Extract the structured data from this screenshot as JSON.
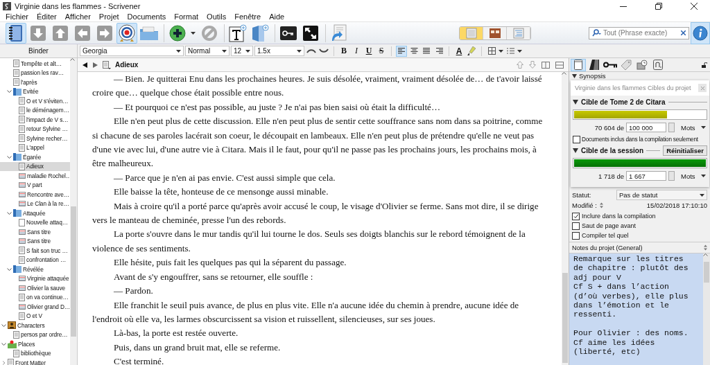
{
  "window": {
    "title": "Virginie dans les flammes - Scrivener"
  },
  "menu": [
    "Fichier",
    "Éditer",
    "Afficher",
    "Projet",
    "Documents",
    "Format",
    "Outils",
    "Fenêtre",
    "Aide"
  ],
  "toolbar": {
    "buttons": [
      {
        "kind": "binder",
        "selected": true
      },
      {
        "kind": "down",
        "selected": false
      },
      {
        "kind": "up",
        "selected": false
      },
      {
        "kind": "left",
        "selected": false
      },
      {
        "kind": "right",
        "selected": false
      },
      {
        "kind": "target",
        "selected": true
      },
      {
        "kind": "folder",
        "selected": false
      },
      {
        "kind": "add",
        "selected": false
      },
      {
        "kind": "delete",
        "selected": false
      },
      {
        "kind": "new-text",
        "selected": false
      },
      {
        "kind": "new-document",
        "selected": false
      },
      {
        "kind": "keywords",
        "selected": false
      },
      {
        "kind": "fullscreen",
        "selected": false
      },
      {
        "kind": "import",
        "selected": false
      }
    ],
    "view_modes": [
      {
        "kind": "document",
        "selected": true
      },
      {
        "kind": "corkboard",
        "selected": false
      },
      {
        "kind": "outline",
        "selected": false
      }
    ],
    "search": {
      "placeholder": "Tout (Phrase exacte)"
    }
  },
  "binder": {
    "title": "Binder",
    "draft_items": [
      {
        "label": "Tempête et alt…",
        "kind": "text",
        "selected": false
      },
      {
        "label": "passion les rav…",
        "kind": "text",
        "selected": false
      },
      {
        "label": "l'après",
        "kind": "text",
        "selected": false
      },
      {
        "label": "Evitée",
        "kind": "folder",
        "selected": false,
        "expanded": true,
        "children": [
          {
            "label": "O et V s'éviten…",
            "kind": "text",
            "selected": false
          },
          {
            "label": "le déménagem…",
            "kind": "text",
            "selected": false
          },
          {
            "label": "l'impact de V s…",
            "kind": "text",
            "selected": false
          },
          {
            "label": "retour Sylvine …",
            "kind": "text",
            "selected": false
          },
          {
            "label": "Sylvine recher…",
            "kind": "text",
            "selected": false
          },
          {
            "label": "L'appel",
            "kind": "text",
            "selected": false
          }
        ]
      },
      {
        "label": "Égarée",
        "kind": "folder",
        "selected": false,
        "expanded": true,
        "children": [
          {
            "label": "Adieux",
            "kind": "text",
            "selected": true
          },
          {
            "label": "maladie Rochel…",
            "kind": "card",
            "selected": false
          },
          {
            "label": "V part",
            "kind": "card",
            "selected": false
          },
          {
            "label": "Rencontre ave…",
            "kind": "card",
            "selected": false
          },
          {
            "label": "Le Clan à la re…",
            "kind": "card",
            "selected": false
          }
        ]
      },
      {
        "label": "Attaquée",
        "kind": "folder",
        "selected": false,
        "expanded": true,
        "children": [
          {
            "label": "Nouvelle attaq…",
            "kind": "blank",
            "selected": false
          },
          {
            "label": "Sans titre",
            "kind": "card",
            "selected": false
          },
          {
            "label": "Sans titre",
            "kind": "card",
            "selected": false
          },
          {
            "label": "S fait son truc …",
            "kind": "text",
            "selected": false
          },
          {
            "label": "confrontation …",
            "kind": "text",
            "selected": false
          }
        ]
      },
      {
        "label": "Révélée",
        "kind": "folder",
        "selected": false,
        "expanded": true,
        "children": [
          {
            "label": "Virginie attaquée",
            "kind": "card",
            "selected": false
          },
          {
            "label": "Olivier la sauve",
            "kind": "card",
            "selected": false
          },
          {
            "label": "on va continue…",
            "kind": "text",
            "selected": false
          },
          {
            "label": "Olivier grand D…",
            "kind": "card",
            "selected": false
          },
          {
            "label": "O et V",
            "kind": "text",
            "selected": false
          }
        ]
      }
    ],
    "root_items": [
      {
        "label": "Characters",
        "kind": "characters",
        "selected": false,
        "expanded": true,
        "children": [
          {
            "label": "persos par ordre…",
            "kind": "text",
            "selected": false
          }
        ]
      },
      {
        "label": "Places",
        "kind": "places",
        "selected": false,
        "expanded": true,
        "children": [
          {
            "label": "bibliothèque",
            "kind": "text",
            "selected": false
          }
        ]
      },
      {
        "label": "Front Matter",
        "kind": "matter",
        "selected": false,
        "expanded": false
      }
    ]
  },
  "format_bar": {
    "font": "Georgia",
    "style": "Normal",
    "size": "12",
    "line_spacing": "1.5x",
    "text_buttons": [
      {
        "kind": "bold",
        "label": "B"
      },
      {
        "kind": "italic",
        "label": "I"
      },
      {
        "kind": "underline",
        "label": "U"
      },
      {
        "kind": "strike",
        "label": "S"
      }
    ],
    "alignments": [
      {
        "kind": "left",
        "selected": true
      },
      {
        "kind": "center",
        "selected": false
      },
      {
        "kind": "justify",
        "selected": false
      },
      {
        "kind": "right",
        "selected": false
      }
    ],
    "text_color": "A"
  },
  "editor": {
    "document": "Adieux",
    "paragraphs": [
      "— Bien. Je quitterai Enu dans les prochaines heures. Je suis désolée, vraiment, vraiment désolée de… de t'avoir laissé croire que… quelque chose était possible entre nous.",
      "— Et pourquoi ce n'est pas possible, au juste ? Je n'ai pas bien saisi où était la difficulté…",
      "Elle n'en peut plus de cette discussion. Elle n'en peut plus de sentir cette souffrance sans nom dans sa poitrine, comme si chacune de ses paroles lacérait son coeur, le découpait en lambeaux. Elle n'en peut plus de prétendre qu'elle ne veut pas d'une vie avec lui, d'une autre vie à Citara. Mais il le faut, pour qu'il ne passe pas les prochains jours, les prochains mois, à être malheureux.",
      "— Parce que je n'en ai pas envie. C'est aussi simple que cela.",
      "Elle baisse la tête, honteuse de ce mensonge aussi minable.",
      "Mais à croire qu'il a porté parce qu'après avoir accusé le coup, le visage d'Olivier se ferme. Sans mot dire, il se dirige vers le manteau de cheminée, presse l'un des rebords.",
      "La porte s'ouvre dans le mur tandis qu'il lui tourne le dos. Seuls ses doigts blanchis sur le rebord témoignent de la violence de ses sentiments.",
      "Elle hésite, puis fait les quelques pas qui la séparent du passage.",
      "Avant de s'y engouffrer, sans se retourner, elle souffle :",
      "— Pardon.",
      "Elle franchit le seuil puis avance, de plus en plus vite. Elle n'a aucune idée du chemin à prendre, aucune idée de l'endroit où elle va, les larmes obscurcissent sa vision et ruissellent, silencieuses, sur ses joues.",
      "Là-bas, la porte est restée ouverte.",
      "Puis, dans un grand bruit mat, elle se referme.",
      "C'est terminé."
    ]
  },
  "inspector": {
    "tabs": [
      {
        "kind": "notes",
        "selected": true
      },
      {
        "kind": "bookmarks",
        "selected": false
      },
      {
        "kind": "keywords",
        "selected": false
      },
      {
        "kind": "metadata",
        "selected": false
      },
      {
        "kind": "snapshots",
        "selected": false
      },
      {
        "kind": "comments",
        "selected": false
      }
    ],
    "synopsis": "Synopsis",
    "targets": {
      "title": "Virginie dans les flammes Cibles du projet",
      "sections": [
        {
          "kind": "draft",
          "title": "Cible de Tome 2 de Citara",
          "level": 0.706,
          "count": "70 604 de",
          "target": "100 000",
          "unit": "Mots",
          "option": {
            "label": "Documents inclus dans la compilation seulement",
            "checked": false
          }
        },
        {
          "kind": "session",
          "title": "Cible de la session",
          "level": 1,
          "count": "1 718 de",
          "target": "1 667",
          "unit": "Mots",
          "reset_button": "Réinitialiser"
        }
      ]
    },
    "status": {
      "label": "Statut:",
      "value": "Pas de statut"
    },
    "modified": {
      "label": "Modifié :",
      "value": "15/02/2018 17:10:10"
    },
    "options": [
      {
        "label": "Inclure dans la compilation",
        "checked": true
      },
      {
        "label": "Saut de page avant",
        "checked": false
      },
      {
        "label": "Compiler tel quel",
        "checked": false
      }
    ],
    "notes": {
      "title": "Notes du projet (General)",
      "text": "Remarque sur les titres de chapitre : plutôt des adj pour V\nCf S + dans l’action (d’où verbes), elle plus dans l’émotion et le ressenti.\n\nPour Olivier : des noms. Cf aime les idées (liberté, etc)"
    }
  }
}
